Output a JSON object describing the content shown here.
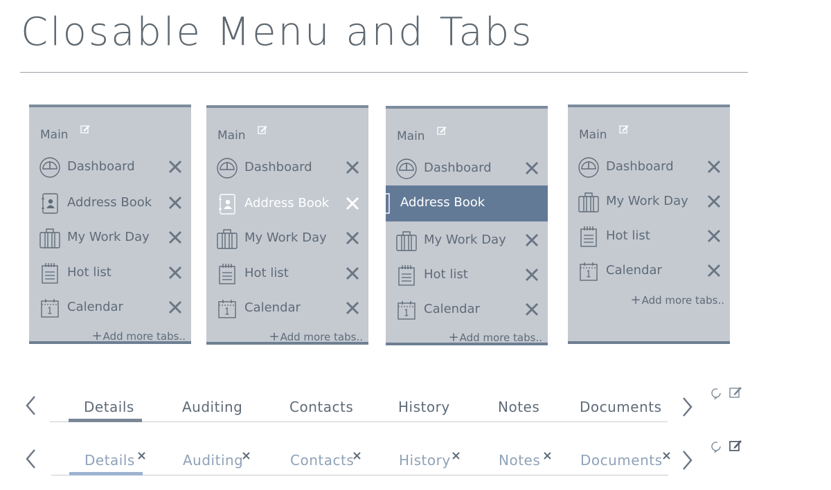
{
  "page": {
    "title": "Closable  Menu and Tabs"
  },
  "panels": [
    {
      "header": "Main",
      "tabs": [
        {
          "label": "Dashboard",
          "icon": "dashboard-icon"
        },
        {
          "label": "Address Book",
          "icon": "address-book-icon"
        },
        {
          "label": "My Work Day",
          "icon": "briefcase-icon"
        },
        {
          "label": "Hot list",
          "icon": "list-icon"
        },
        {
          "label": "Calendar",
          "icon": "calendar-icon"
        }
      ],
      "add_more": "Add more tabs.."
    },
    {
      "header": "Main",
      "tabs": [
        {
          "label": "Dashboard",
          "icon": "dashboard-icon"
        },
        {
          "label": "Address Book",
          "icon": "address-book-icon",
          "state": "hover"
        },
        {
          "label": "My Work Day",
          "icon": "briefcase-icon"
        },
        {
          "label": "Hot list",
          "icon": "list-icon"
        },
        {
          "label": "Calendar",
          "icon": "calendar-icon"
        }
      ],
      "add_more": "Add more tabs.."
    },
    {
      "header": "Main",
      "tabs": [
        {
          "label": "Dashboard",
          "icon": "dashboard-icon"
        },
        {
          "label": "Address Book",
          "icon": "address-book-icon",
          "state": "dragging"
        },
        {
          "label": "My Work Day",
          "icon": "briefcase-icon"
        },
        {
          "label": "Hot list",
          "icon": "list-icon"
        },
        {
          "label": "Calendar",
          "icon": "calendar-icon"
        }
      ],
      "add_more": "Add more tabs.."
    },
    {
      "header": "Main",
      "tabs": [
        {
          "label": "Dashboard",
          "icon": "dashboard-icon"
        },
        {
          "label": "My Work Day",
          "icon": "briefcase-icon"
        },
        {
          "label": "Hot list",
          "icon": "list-icon"
        },
        {
          "label": "Calendar",
          "icon": "calendar-icon"
        }
      ],
      "add_more": "Add more tabs.."
    }
  ],
  "tab_strips": [
    {
      "tabs": [
        "Details",
        "Auditing",
        "Contacts",
        "History",
        "Notes",
        "Documents"
      ],
      "active": "Details",
      "closable": false
    },
    {
      "tabs": [
        "Details",
        "Auditing",
        "Contacts",
        "History",
        "Notes",
        "Documents"
      ],
      "active": "Details",
      "closable": true
    }
  ],
  "colors": {
    "panel_bg": "#c5cad1",
    "panel_border": "#7c8b9c",
    "selected_row": "#637a97",
    "text": "#5f6b78",
    "faded_text": "#8fa2b8",
    "underline_dark": "#7a8796",
    "underline_light": "#9db3cf"
  }
}
